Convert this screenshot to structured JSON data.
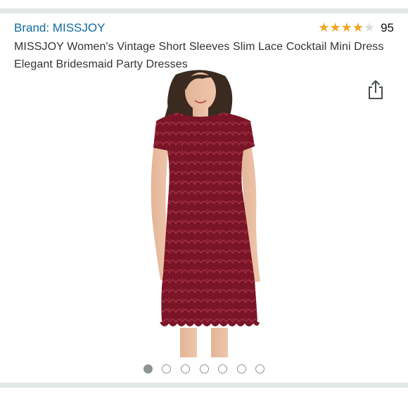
{
  "brand": {
    "label": "Brand: MISSJOY"
  },
  "rating": {
    "stars_glyphs": "★★★★★",
    "value_out_of_5": 4,
    "count": "95"
  },
  "product": {
    "title": "MISSJOY Women's Vintage Short Sleeves Slim Lace Cocktail Mini Dress Elegant Bridesmaid Party Dresses"
  },
  "icons": {
    "share": "share-icon"
  },
  "image": {
    "subject": "product-photo-dress",
    "dress_color": "#7a1427"
  },
  "carousel": {
    "total": 7,
    "active_index": 0
  },
  "colors": {
    "link": "#0f6c9e",
    "star": "#f2a624",
    "divider": "#e3e6e6",
    "dot": "#8d9393"
  }
}
